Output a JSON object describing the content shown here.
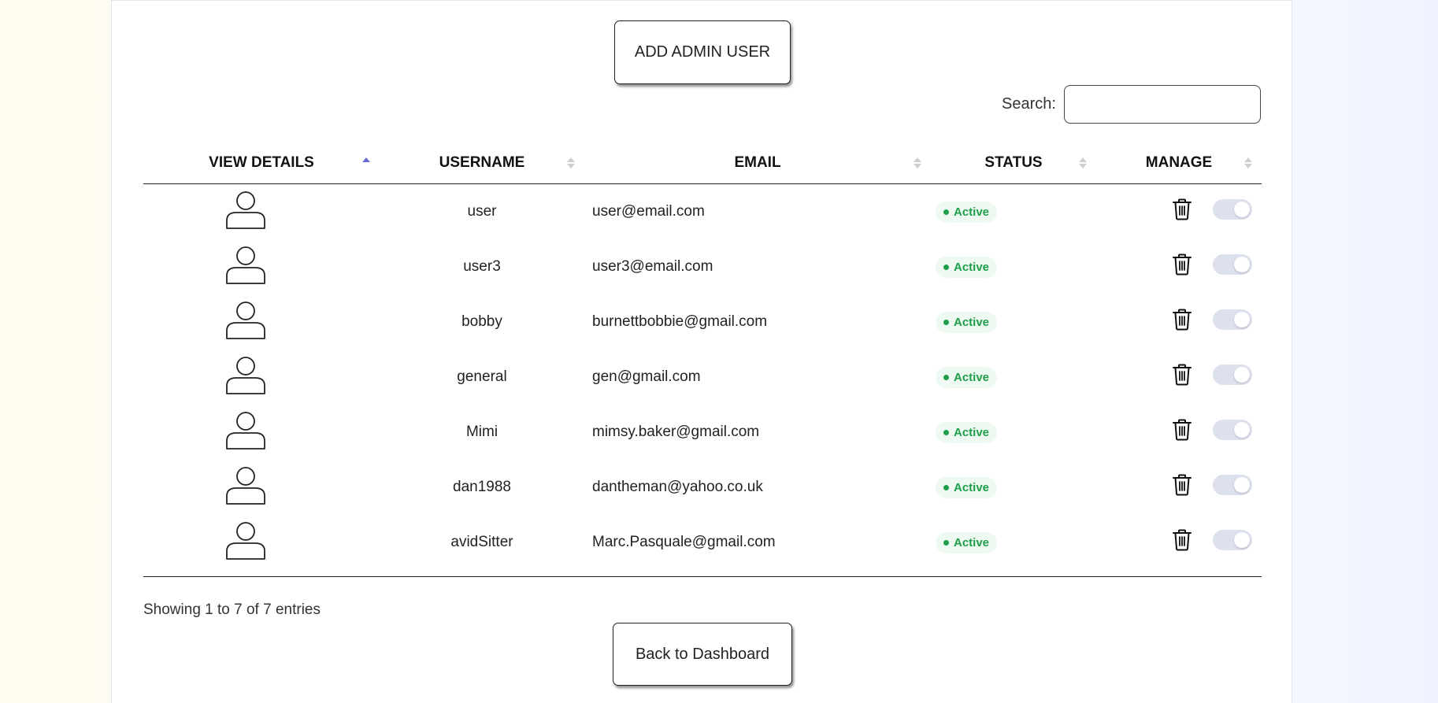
{
  "toolbar": {
    "add_admin_label": "ADD ADMIN USER",
    "back_label": "Back to Dashboard"
  },
  "search": {
    "label": "Search:",
    "value": "",
    "placeholder": ""
  },
  "table": {
    "columns": [
      "VIEW DETAILS",
      "USERNAME",
      "EMAIL",
      "STATUS",
      "MANAGE"
    ],
    "sorted_column": "VIEW DETAILS",
    "sort_direction": "ascending",
    "rows": [
      {
        "username": "user",
        "email": "user@email.com",
        "status": "Active"
      },
      {
        "username": "user3",
        "email": "user3@email.com",
        "status": "Active"
      },
      {
        "username": "bobby",
        "email": "burnettbobbie@gmail.com",
        "status": "Active"
      },
      {
        "username": "general",
        "email": "gen@gmail.com",
        "status": "Active"
      },
      {
        "username": "Mimi",
        "email": "mimsy.baker@gmail.com",
        "status": "Active"
      },
      {
        "username": "dan1988",
        "email": "dantheman@yahoo.co.uk",
        "status": "Active"
      },
      {
        "username": "avidSitter",
        "email": "Marc.Pasquale@gmail.com",
        "status": "Active"
      }
    ],
    "info": "Showing 1 to 7 of 7 entries"
  },
  "icons": {
    "avatar": "user-outline-icon",
    "delete": "trash-icon",
    "toggle": "toggle-switch"
  },
  "colors": {
    "status_active_text": "#1e9e4a",
    "status_active_bg": "#eefaf1",
    "sort_active": "#6b6bd6",
    "toggle_track": "#dde1ee"
  }
}
